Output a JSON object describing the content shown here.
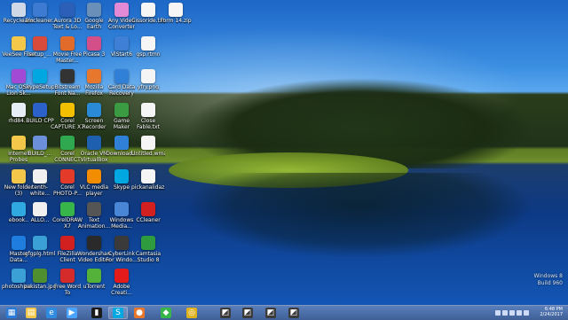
{
  "desktop": {
    "icons": [
      {
        "label": "Recycle Bin",
        "icon": "recycle-bin-icon",
        "color": "#cfd8e6"
      },
      {
        "label": "VeeSee Files",
        "icon": "folder-icon",
        "color": "#f3c84a"
      },
      {
        "label": "Mac OS X\nLion Sk...",
        "icon": "shortcut-icon",
        "color": "#a24ad6"
      },
      {
        "label": "rhd84...",
        "icon": "file-icon",
        "color": "#e8eef6"
      },
      {
        "label": "Internet\nProbes",
        "icon": "folder-icon",
        "color": "#f3c84a"
      },
      {
        "label": "New folder\n(3)",
        "icon": "folder-icon",
        "color": "#f3c84a"
      },
      {
        "label": "ebook..",
        "icon": "app-icon",
        "color": "#2fa9e0"
      },
      {
        "label": "Master Data...",
        "icon": "world-icon",
        "color": "#1f7de0"
      },
      {
        "label": "photoshine...",
        "icon": "image-icon",
        "color": "#3aa0d6"
      },
      {
        "label": "iamcleaner...",
        "icon": "gear-icon",
        "color": "#3c7bd1"
      },
      {
        "label": "setup_...",
        "icon": "setup-icon",
        "color": "#d84a3a"
      },
      {
        "label": "SkypeSetup...",
        "icon": "app-icon",
        "color": "#00a7e0"
      },
      {
        "label": "BUILD CPP",
        "icon": "app-icon",
        "color": "#2b61c9"
      },
      {
        "label": "BUILD_...",
        "icon": "app-icon",
        "color": "#6b8fd9"
      },
      {
        "label": "tenth-white...",
        "icon": "file-icon",
        "color": "#f0f0f0"
      },
      {
        "label": "ALLO...",
        "icon": "file-icon",
        "color": "#f0f0f0"
      },
      {
        "label": "gfgplg.html",
        "icon": "web-icon",
        "color": "#3aa0d6"
      },
      {
        "label": "pakistan.jpg",
        "icon": "image-icon",
        "color": "#4f8f2f"
      },
      {
        "label": "Aurora 3D\nText & Lo...",
        "icon": "app-icon",
        "color": "#2c5fb8"
      },
      {
        "label": "Movie Free\nMaster...",
        "icon": "app-icon",
        "color": "#e06b2a"
      },
      {
        "label": "Bitstream\nFont Na...",
        "icon": "app-icon",
        "color": "#333333"
      },
      {
        "label": "Corel\nCAPTURE X7",
        "icon": "app-icon",
        "color": "#f2c000"
      },
      {
        "label": "Corel\nCONNECT X7",
        "icon": "app-icon",
        "color": "#2fa84f"
      },
      {
        "label": "Corel\nPHOTO-P...",
        "icon": "app-icon",
        "color": "#e33a2a"
      },
      {
        "label": "CorelDRAW\nX7",
        "icon": "app-icon",
        "color": "#37b54a"
      },
      {
        "label": "FileZilla\nClient",
        "icon": "app-icon",
        "color": "#d21f1f"
      },
      {
        "label": "Free Word To\nPDF",
        "icon": "app-icon",
        "color": "#d62b2b"
      },
      {
        "label": "Google Earth\nPro",
        "icon": "globe-icon",
        "color": "#6a8fb8"
      },
      {
        "label": "Picasa 3",
        "icon": "app-icon",
        "color": "#d24f8a"
      },
      {
        "label": "Mozilla\nFirefox",
        "icon": "firefox-icon",
        "color": "#e8772e"
      },
      {
        "label": "Screen\nRecorder",
        "icon": "app-icon",
        "color": "#2a8ad6"
      },
      {
        "label": "Oracle VM\nVirtualBox",
        "icon": "app-icon",
        "color": "#1f5fb0"
      },
      {
        "label": "VLC media\nplayer",
        "icon": "vlc-icon",
        "color": "#f28c00"
      },
      {
        "label": "Text\nAnimation...",
        "icon": "app-icon",
        "color": "#555555"
      },
      {
        "label": "Wondershare\nVideo Editor",
        "icon": "app-icon",
        "color": "#2a2a2a"
      },
      {
        "label": "uTorrent",
        "icon": "utorrent-icon",
        "color": "#54b13a"
      },
      {
        "label": "Any Video\nConverter",
        "icon": "app-icon",
        "color": "#e38ad6"
      },
      {
        "label": "ViStart6",
        "icon": "app-icon",
        "color": "#3f7fd6"
      },
      {
        "label": "Card Data\nRecovery",
        "icon": "app-icon",
        "color": "#2f80d6"
      },
      {
        "label": "Game Maker",
        "icon": "app-icon",
        "color": "#3a9b42"
      },
      {
        "label": "Download...",
        "icon": "app-icon",
        "color": "#2f80d6"
      },
      {
        "label": "Skype",
        "icon": "skype-icon",
        "color": "#00a7e0"
      },
      {
        "label": "Windows\nMedia...",
        "icon": "app-icon",
        "color": "#4a86d6"
      },
      {
        "label": "CyberLink\nFor Windo...",
        "icon": "app-icon",
        "color": "#3a3a3a"
      },
      {
        "label": "Adobe\nCreati...",
        "icon": "app-icon",
        "color": "#e31b1b"
      },
      {
        "label": "Cissoride.txt",
        "icon": "file-icon",
        "color": "#f5f5f5"
      },
      {
        "label": "gsp.rtmn",
        "icon": "file-icon",
        "color": "#f5f5f5"
      },
      {
        "label": "yfry.png",
        "icon": "image-icon",
        "color": "#f5f5f5"
      },
      {
        "label": "Close\nFable.txt",
        "icon": "file-icon",
        "color": "#f5f5f5"
      },
      {
        "label": "Untitled.wma",
        "icon": "file-icon",
        "color": "#f5f5f5"
      },
      {
        "label": "pickanalidaz...",
        "icon": "image-icon",
        "color": "#f5f5f5"
      },
      {
        "label": "CCleaner",
        "icon": "ccleaner-icon",
        "color": "#d21f1f"
      },
      {
        "label": "Camtasia\nStudio 8",
        "icon": "app-icon",
        "color": "#2e9b3f"
      },
      {
        "label": "Form 14.zip",
        "icon": "zip-icon",
        "color": "#f5f5f5"
      }
    ]
  },
  "watermark": {
    "line1": "Windows 8",
    "line2": "Build 960"
  },
  "taskbar": {
    "buttons": [
      {
        "name": "start-button",
        "icon": "windows-icon",
        "color": "#2a7bd8",
        "glyph": "▦"
      },
      {
        "name": "file-explorer-button",
        "icon": "folder-icon",
        "color": "#f3c84a",
        "glyph": "▤"
      },
      {
        "name": "internet-explorer-button",
        "icon": "ie-icon",
        "color": "#2f8be0",
        "glyph": "e"
      },
      {
        "name": "media-player-button",
        "icon": "play-icon",
        "color": "#4aa3ff",
        "glyph": "▶"
      },
      {
        "name": "command-prompt-button",
        "icon": "terminal-icon",
        "color": "#1b1b1b",
        "glyph": "▮"
      },
      {
        "name": "skype-button",
        "icon": "skype-icon",
        "color": "#00a7e0",
        "glyph": "S"
      },
      {
        "name": "firefox-button",
        "icon": "firefox-icon",
        "color": "#e8772e",
        "glyph": "●"
      },
      {
        "name": "coreldraw-button",
        "icon": "app-icon",
        "color": "#37b54a",
        "glyph": "◆"
      },
      {
        "name": "chrome-button",
        "icon": "chrome-icon",
        "color": "#e0b21c",
        "glyph": "◎"
      },
      {
        "name": "app-button-10",
        "icon": "app-icon",
        "color": "#3b3b3b",
        "glyph": "◩"
      },
      {
        "name": "app-button-11",
        "icon": "app-icon",
        "color": "#3b3b3b",
        "glyph": "◩"
      },
      {
        "name": "app-button-12",
        "icon": "app-icon",
        "color": "#3b3b3b",
        "glyph": "◩"
      },
      {
        "name": "app-button-13",
        "icon": "app-icon",
        "color": "#3b3b3b",
        "glyph": "◩"
      }
    ],
    "clock": {
      "time": "6:48 PM",
      "date": "2/24/2017"
    }
  }
}
